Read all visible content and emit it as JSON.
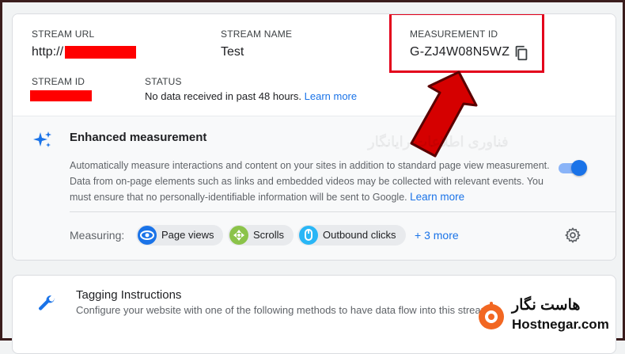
{
  "stream": {
    "url_label": "STREAM URL",
    "url_value": "http://",
    "name_label": "STREAM NAME",
    "name_value": "Test",
    "measurement_label": "MEASUREMENT ID",
    "measurement_value": "G-ZJ4W08N5WZ",
    "id_label": "STREAM ID",
    "status_label": "STATUS",
    "status_text": "No data received in past 48 hours.",
    "status_link": "Learn more"
  },
  "enhanced": {
    "title": "Enhanced measurement",
    "desc_line1": "Automatically measure interactions and content on your sites in addition to standard page view measurement.",
    "desc_line2": "Data from on-page elements such as links and embedded videos may be collected with relevant events. You",
    "desc_line3": "must ensure that no personally-identifiable information will be sent to Google.",
    "desc_link": "Learn more",
    "toggle_on": true,
    "measuring_label": "Measuring:",
    "chips": [
      {
        "label": "Page views",
        "icon": "eye-icon",
        "color": "#1a73e8"
      },
      {
        "label": "Scrolls",
        "icon": "crosshair-icon",
        "color": "#34a853"
      },
      {
        "label": "Outbound clicks",
        "icon": "mouse-icon",
        "color": "#1a73e8"
      }
    ],
    "more_label": "+ 3 more"
  },
  "tagging": {
    "title": "Tagging Instructions",
    "desc": "Configure your website with one of the following methods to have data flow into this stream"
  },
  "watermark": {
    "brand_fa": "هاست نگار",
    "brand_en": "Hostnegar.com",
    "fa_sub": "فناوری اطلاعات رایانگار"
  },
  "colors": {
    "accent": "#1a73e8",
    "redaction": "#ff0000",
    "highlight": "#e3001b",
    "brand_orange": "#f26722"
  }
}
